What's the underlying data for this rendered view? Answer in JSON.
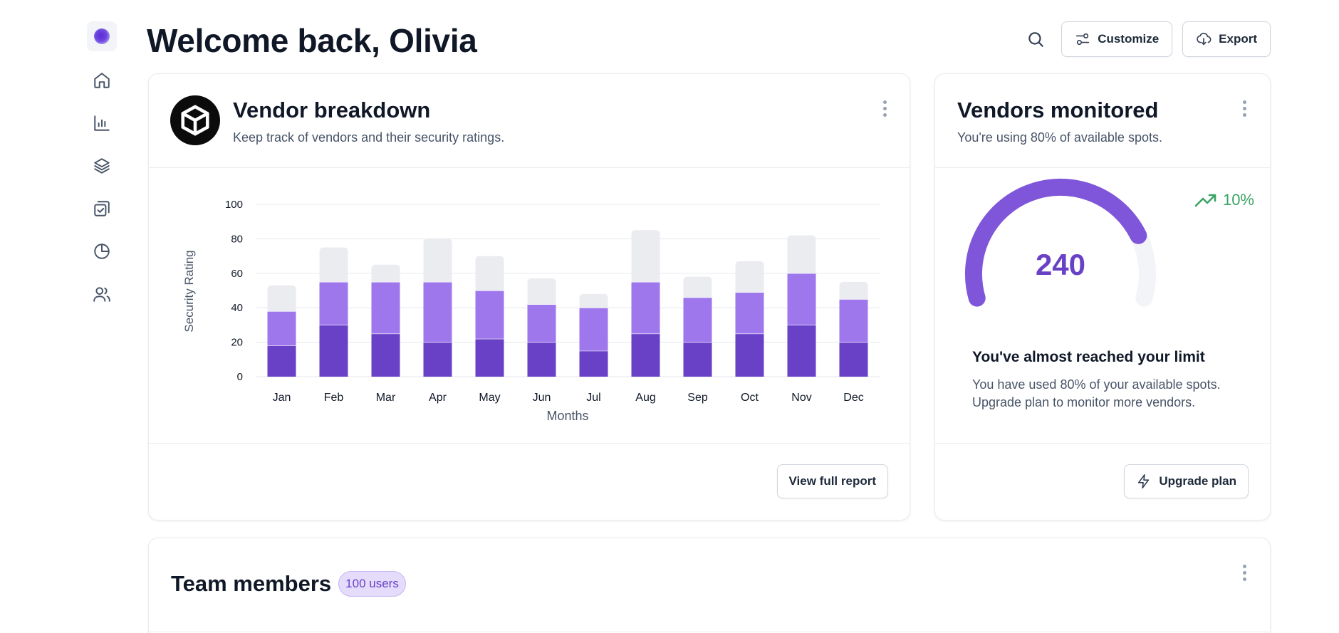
{
  "header": {
    "title": "Welcome back, Olivia",
    "customize_label": "Customize",
    "export_label": "Export"
  },
  "sidebar": {
    "items": [
      {
        "icon": "home-icon"
      },
      {
        "icon": "bar-chart-icon"
      },
      {
        "icon": "layers-icon"
      },
      {
        "icon": "check-square-icon"
      },
      {
        "icon": "pie-chart-icon"
      },
      {
        "icon": "users-icon"
      }
    ]
  },
  "vendor_breakdown": {
    "title": "Vendor breakdown",
    "subtitle": "Keep track of vendors and their security ratings.",
    "button_label": "View full report"
  },
  "chart_data": {
    "type": "bar",
    "stacked": true,
    "categories": [
      "Jan",
      "Feb",
      "Mar",
      "Apr",
      "May",
      "Jun",
      "Jul",
      "Aug",
      "Sep",
      "Oct",
      "Nov",
      "Dec"
    ],
    "series": [
      {
        "values": [
          18,
          30,
          25,
          20,
          22,
          20,
          15,
          25,
          20,
          25,
          30,
          20
        ],
        "color": "#6941c6"
      },
      {
        "values": [
          20,
          25,
          30,
          35,
          28,
          22,
          25,
          30,
          26,
          24,
          30,
          25
        ],
        "color": "#9e77ed"
      },
      {
        "values": [
          15,
          20,
          10,
          25,
          20,
          15,
          8,
          30,
          12,
          18,
          22,
          10
        ],
        "color": "#eaecf0"
      }
    ],
    "xlabel": "Months",
    "ylabel": "Security Rating",
    "ylim": [
      0,
      100
    ],
    "yticks": [
      "0",
      "20",
      "40",
      "60",
      "80",
      "100"
    ],
    "grid": true
  },
  "vendors_monitored": {
    "title": "Vendors monitored",
    "subtitle": "You're using 80% of available spots.",
    "value": "240",
    "fill_fraction": 0.8,
    "trend": "10%",
    "limit_title": "You've almost reached your limit",
    "limit_line1": "You have used 80% of your available spots.",
    "limit_line2": "Upgrade plan to monitor more vendors.",
    "button_label": "Upgrade plan"
  },
  "team": {
    "title": "Team members",
    "badge": "100 users"
  },
  "colors": {
    "primary": "#6941c6",
    "secondary": "#9e77ed",
    "track": "#f2f4f7",
    "positive": "#3aa366"
  }
}
